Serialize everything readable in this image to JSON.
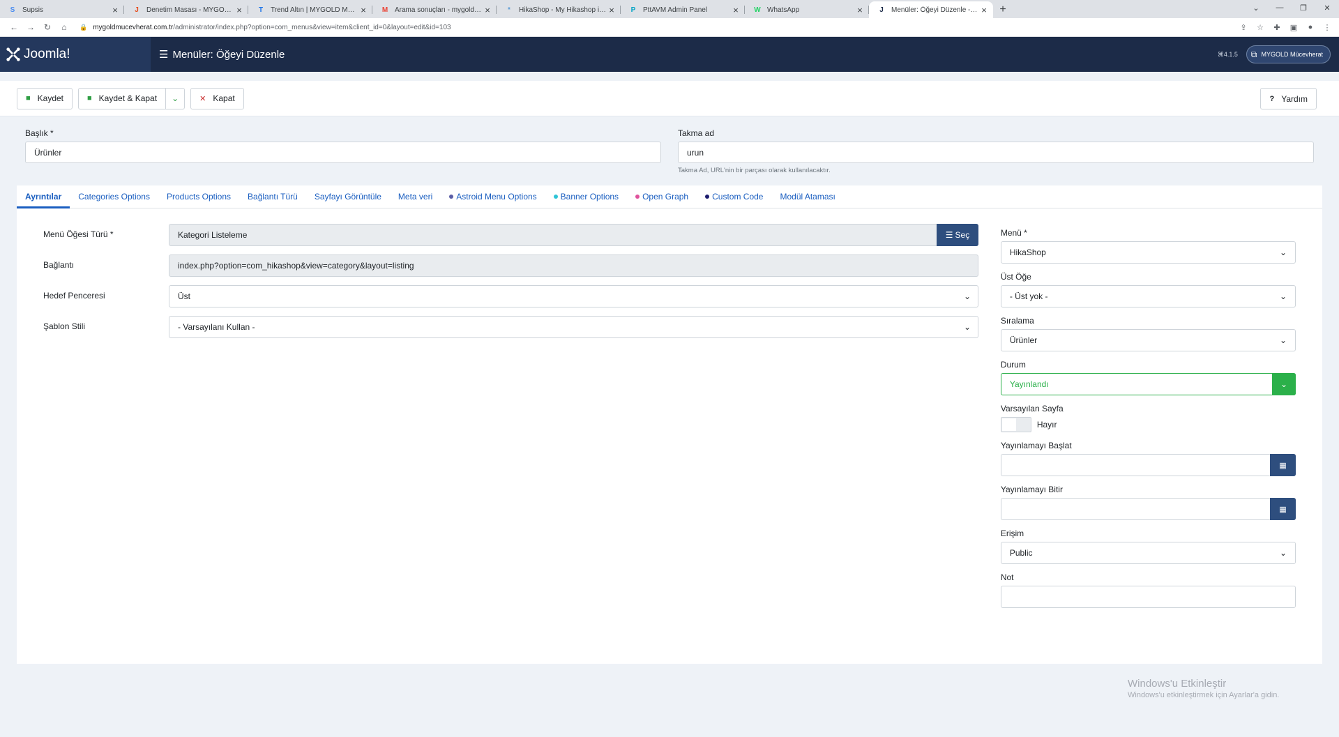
{
  "browser": {
    "tabs": [
      {
        "title": "Supsis",
        "fav": "S",
        "color": "#4a8cf0",
        "active": false
      },
      {
        "title": "Denetim Masası - MYGOLD Mücevherat",
        "fav": "J",
        "color": "#e64a19",
        "active": false
      },
      {
        "title": "Trend Altın | MYGOLD Mücevherat",
        "fav": "T",
        "color": "#1a73e8",
        "active": false
      },
      {
        "title": "Arama sonuçları - mygoldmucevherat",
        "fav": "M",
        "color": "#ea4335",
        "active": false
      },
      {
        "title": "HikaShop - My Hikashop is displayed",
        "fav": "*",
        "color": "#5a9bd5",
        "active": false
      },
      {
        "title": "PttAVM Admin Panel",
        "fav": "P",
        "color": "#00a3c4",
        "active": false
      },
      {
        "title": "WhatsApp",
        "fav": "W",
        "color": "#25d366",
        "active": false
      },
      {
        "title": "Menüler: Öğeyi Düzenle - MYGOLD",
        "fav": "J",
        "color": "#1c2b48",
        "active": true
      }
    ],
    "url_host": "mygoldmucevherat.com.tr",
    "url_path": "/administrator/index.php?option=com_menus&view=item&client_id=0&layout=edit&id=103"
  },
  "header": {
    "logo_text": "Joomla!",
    "page_title": "Menüler: Öğeyi Düzenle",
    "version": "4.1.5",
    "user_label": "MYGOLD Mücevherat"
  },
  "toolbar": {
    "save": "Kaydet",
    "save_close": "Kaydet & Kapat",
    "close": "Kapat",
    "help": "Yardım"
  },
  "form": {
    "title_label": "Başlık *",
    "title_value": "Ürünler",
    "alias_label": "Takma ad",
    "alias_value": "urun",
    "alias_hint": "Takma Ad, URL'nin bir parçası olarak kullanılacaktır."
  },
  "tabs": [
    {
      "label": "Ayrıntılar",
      "dot": ""
    },
    {
      "label": "Categories Options",
      "dot": ""
    },
    {
      "label": "Products Options",
      "dot": ""
    },
    {
      "label": "Bağlantı Türü",
      "dot": ""
    },
    {
      "label": "Sayfayı Görüntüle",
      "dot": ""
    },
    {
      "label": "Meta veri",
      "dot": ""
    },
    {
      "label": "Astroid Menu Options",
      "dot": "#5b5ea6"
    },
    {
      "label": "Banner Options",
      "dot": "#2ec4d6"
    },
    {
      "label": "Open Graph",
      "dot": "#e0529c"
    },
    {
      "label": "Custom Code",
      "dot": "#1c1c6e"
    },
    {
      "label": "Modül Ataması",
      "dot": ""
    }
  ],
  "details": {
    "type_label": "Menü Öğesi Türü *",
    "type_value": "Kategori Listeleme",
    "select_btn": "Seç",
    "link_label": "Bağlantı",
    "link_value": "index.php?option=com_hikashop&view=category&layout=listing",
    "target_label": "Hedef Penceresi",
    "target_value": "Üst",
    "template_label": "Şablon Stili",
    "template_value": "- Varsayılanı Kullan -"
  },
  "sidebar": {
    "menu_label": "Menü *",
    "menu_value": "HikaShop",
    "parent_label": "Üst Öğe",
    "parent_value": "- Üst yok -",
    "order_label": "Sıralama",
    "order_value": "Ürünler",
    "status_label": "Durum",
    "status_value": "Yayınlandı",
    "default_label": "Varsayılan Sayfa",
    "default_value": "Hayır",
    "publish_up_label": "Yayınlamayı Başlat",
    "publish_down_label": "Yayınlamayı Bitir",
    "access_label": "Erişim",
    "access_value": "Public",
    "note_label": "Not"
  },
  "watermark": {
    "line1": "Windows'u Etkinleştir",
    "line2": "Windows'u etkinleştirmek için Ayarlar'a gidin."
  },
  "colors": {
    "header_bg": "#1c2b48",
    "accent": "#2e4e7e",
    "published": "#2bb04a",
    "link": "#1a5ec0"
  }
}
